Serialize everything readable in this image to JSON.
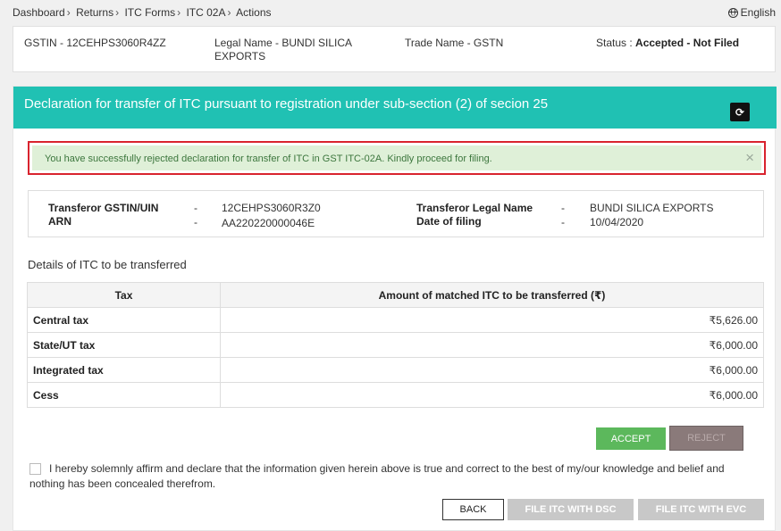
{
  "breadcrumb": [
    "Dashboard",
    "Returns",
    "ITC Forms",
    "ITC 02A",
    "Actions"
  ],
  "language": "English",
  "info": {
    "gstin": "GSTIN - 12CEHPS3060R4ZZ",
    "legal_name_line1": "Legal Name - BUNDI SILICA",
    "legal_name_line2": "EXPORTS",
    "trade_name": "Trade Name - GSTN",
    "status_label": "Status :",
    "status_value": "Accepted - Not Filed"
  },
  "card": {
    "title": "Declaration for transfer of ITC pursuant to registration under sub-section (2) of secion 25",
    "refresh_icon": "refresh-icon"
  },
  "alert": {
    "message": "You have successfully rejected declaration for transfer of ITC in GST ITC-02A. Kindly proceed for filing.",
    "close": "×"
  },
  "details": {
    "transferor_gstin_label": "Transferor GSTIN/UIN",
    "transferor_gstin_value": "12CEHPS3060R3Z0",
    "arn_label": "ARN",
    "arn_value": "AA220220000046E",
    "legal_name_label": "Transferor Legal Name",
    "legal_name_value": "BUNDI SILICA EXPORTS",
    "date_label": "Date of filing",
    "date_value": "10/04/2020",
    "dash": "-"
  },
  "section_title": "Details of ITC to be transferred",
  "table": {
    "headers": [
      "Tax",
      "Amount of matched ITC to be transferred (₹)"
    ],
    "rows": [
      {
        "tax": "Central tax",
        "amount": "₹5,626.00"
      },
      {
        "tax": "State/UT tax",
        "amount": "₹6,000.00"
      },
      {
        "tax": "Integrated tax",
        "amount": "₹6,000.00"
      },
      {
        "tax": "Cess",
        "amount": "₹6,000.00"
      }
    ]
  },
  "buttons": {
    "accept": "ACCEPT",
    "reject": "REJECT",
    "back": "BACK",
    "file_dsc": "FILE ITC WITH DSC",
    "file_evc": "FILE ITC WITH EVC"
  },
  "affirmation": "I hereby solemnly affirm and declare that the information given herein above is true and correct to the best of my/our knowledge and belief and nothing has been concealed therefrom.",
  "colors": {
    "header_teal": "#20c1b3",
    "alert_bg": "#dff0d8",
    "alert_border": "#d9232e",
    "accept_green": "#5cb85c"
  }
}
